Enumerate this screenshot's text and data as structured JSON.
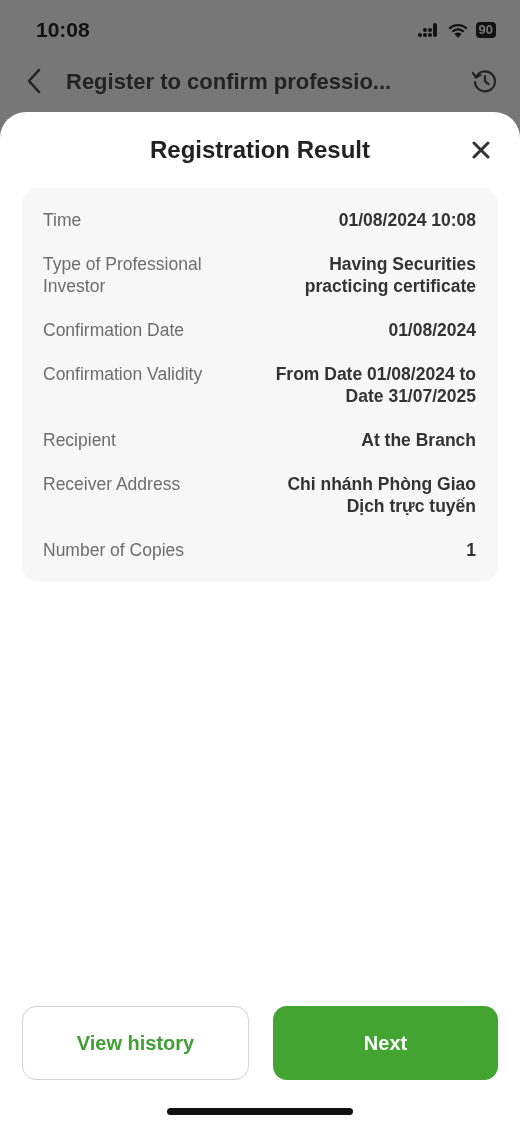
{
  "status_bar": {
    "time": "10:08",
    "battery": "90"
  },
  "header": {
    "title": "Register to confirm professio..."
  },
  "sheet": {
    "title": "Registration Result",
    "rows": [
      {
        "label": "Time",
        "value": "01/08/2024 10:08"
      },
      {
        "label": "Type of Professional Investor",
        "value": "Having Securities practicing certificate"
      },
      {
        "label": "Confirmation Date",
        "value": "01/08/2024"
      },
      {
        "label": "Confirmation Validity",
        "value": "From Date 01/08/2024 to Date 31/07/2025"
      },
      {
        "label": "Recipient",
        "value": "At the Branch"
      },
      {
        "label": "Receiver Address",
        "value": "Chi nhánh Phòng Giao Dịch trực tuyến"
      },
      {
        "label": "Number of Copies",
        "value": "1"
      }
    ],
    "buttons": [
      {
        "label": "View history",
        "kind": "outline"
      },
      {
        "label": "Next",
        "kind": "primary"
      }
    ]
  }
}
